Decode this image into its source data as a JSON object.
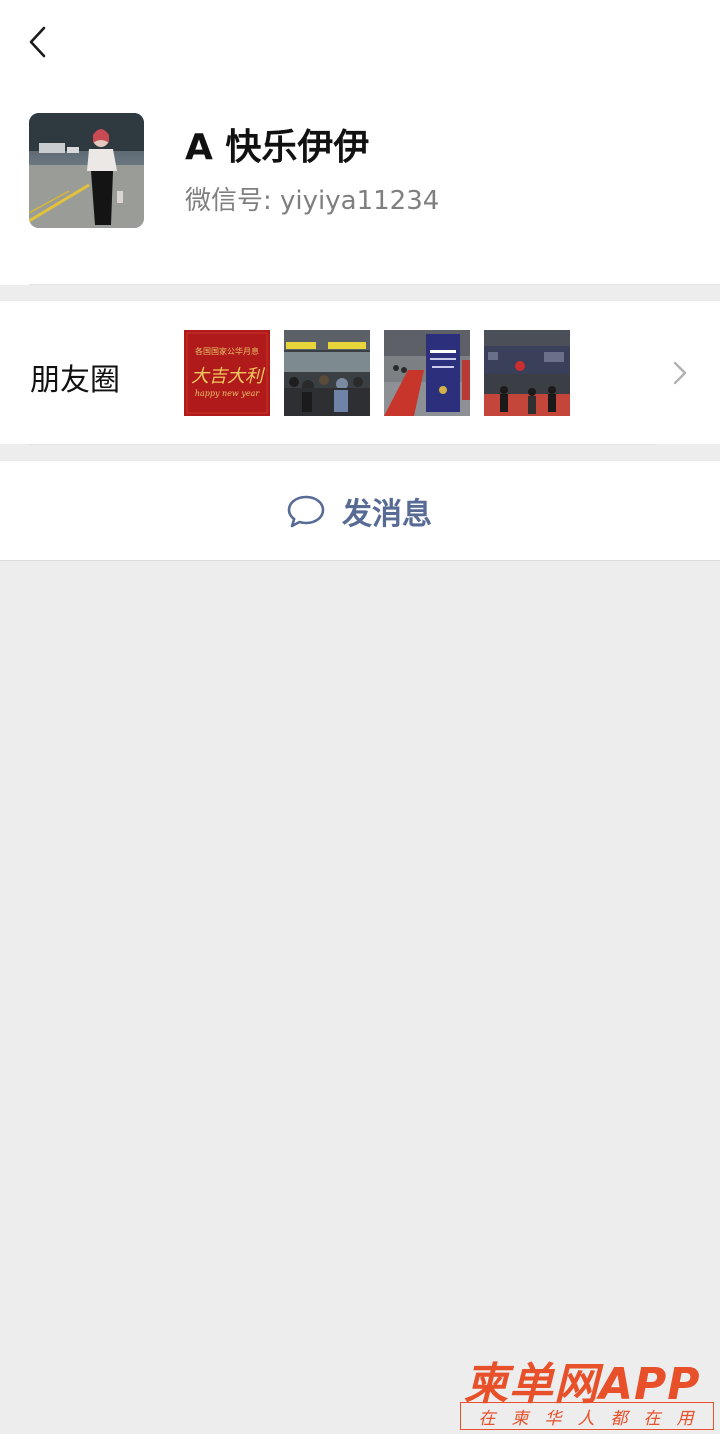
{
  "header": {
    "back_icon": "chevron-left-icon"
  },
  "profile": {
    "name": "A 快乐伊伊",
    "wechat_id": "微信号:  yiyiya11234",
    "avatar": "avatar-photo"
  },
  "moments": {
    "label": "朋友圈",
    "thumbnails": [
      {
        "name": "moments-thumb-greeting-card",
        "text_top": "各国国家公华月息",
        "text_main": "大吉大利",
        "text_sub": "happy new year"
      },
      {
        "name": "moments-thumb-airport-crowd"
      },
      {
        "name": "moments-thumb-terminal-banner"
      },
      {
        "name": "moments-thumb-hall-crowd"
      }
    ],
    "more_icon": "chevron-right-icon"
  },
  "actions": {
    "message_label": "发消息",
    "message_icon": "chat-bubble-icon"
  },
  "watermark": {
    "main": "柬单网APP",
    "sub": "在柬华人都在用"
  },
  "colors": {
    "link_blue": "#576b95",
    "background": "#ededed",
    "watermark_orange": "#e8502a"
  }
}
